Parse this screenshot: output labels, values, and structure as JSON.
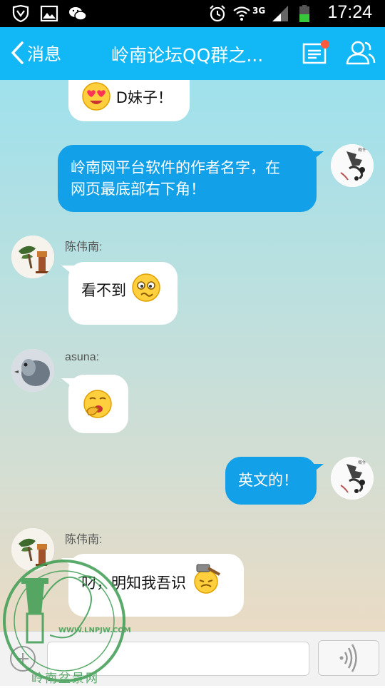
{
  "status_bar": {
    "time": "17:24",
    "network": "3G",
    "left_icons": [
      "shield-icon",
      "image-icon",
      "wechat-icon"
    ],
    "right_icons": [
      "alarm-icon",
      "wifi-icon",
      "signal-icon",
      "battery-icon"
    ]
  },
  "header": {
    "back_label": "消息",
    "title": "岭南论坛QQ群之...",
    "icons": [
      "message-list-icon",
      "contacts-icon"
    ]
  },
  "messages": [
    {
      "side": "in",
      "sender": "",
      "text": "D妹子！",
      "emoji": "heart-eyes-emoji-icon"
    },
    {
      "side": "out",
      "text_line1": "岭南网平台软件的作者名字，在",
      "text_line2": "网页最底部右下角！"
    },
    {
      "side": "in",
      "sender": "陈伟南:",
      "text": "看不到",
      "emoji": "confused-emoji-icon"
    },
    {
      "side": "in",
      "sender": "asuna:",
      "text": "",
      "emoji": "yawn-emoji-icon"
    },
    {
      "side": "out",
      "text": "英文的！"
    },
    {
      "side": "in",
      "sender": "陈伟南:",
      "text": "叼，明知我吾识",
      "emoji": "hammer-emoji-icon"
    }
  ],
  "input_bar": {
    "placeholder": "",
    "icons": [
      "plus-icon",
      "voice-icon"
    ]
  },
  "watermark": {
    "url": "WWW.LNPJW.COM",
    "name": "岭南盆景网"
  },
  "colors": {
    "header_bg": "#12b7f5",
    "out_bubble": "#12a0e8",
    "in_bubble": "#ffffff",
    "chat_bg_top": "#9fe1ec",
    "chat_bg_bottom": "#eadbc5"
  }
}
